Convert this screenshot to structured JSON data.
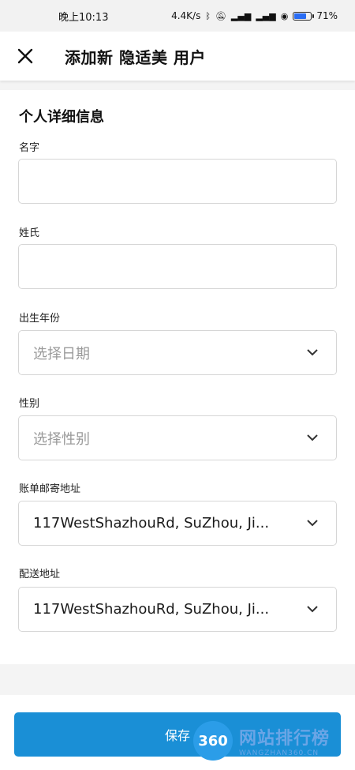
{
  "status_bar": {
    "time": "晚上10:13",
    "speed": "4.4K/s",
    "battery": "71",
    "battery_level": 0.71
  },
  "header": {
    "title": "添加新 隐适美 用户"
  },
  "section": {
    "title": "个人详细信息"
  },
  "fields": {
    "first_name_label": "名字",
    "first_name_value": "",
    "last_name_label": "姓氏",
    "last_name_value": "",
    "birth_year_label": "出生年份",
    "birth_year_placeholder": "选择日期",
    "gender_label": "性别",
    "gender_placeholder": "选择性别",
    "billing_address_label": "账单邮寄地址",
    "billing_address_value": "117WestShazhouRd, SuZhou, Ji...",
    "shipping_address_label": "配送地址",
    "shipping_address_value": "117WestShazhouRd, SuZhou, Ji..."
  },
  "actions": {
    "save_label": "保存"
  },
  "watermark": {
    "logo_text": "360",
    "main_text": "网站排行榜",
    "sub_text": "WANGZHAN360.CN"
  },
  "colors": {
    "accent": "#1a8fd6",
    "background": "#f4f4f4",
    "card": "#ffffff"
  }
}
